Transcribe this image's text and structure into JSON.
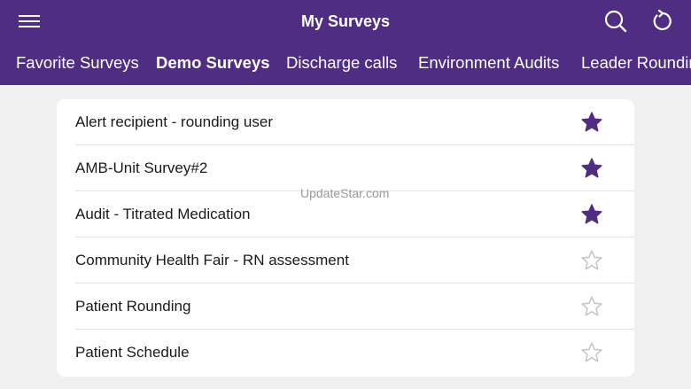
{
  "header": {
    "title": "My Surveys",
    "background_color": "#4e2d82",
    "menu_icon": "hamburger-menu-icon",
    "search_icon": "search-icon",
    "refresh_icon": "refresh-icon"
  },
  "tabs": [
    {
      "label": "Favorite Surveys",
      "active": false
    },
    {
      "label": "Demo Surveys",
      "active": true
    },
    {
      "label": "Discharge calls",
      "active": false
    },
    {
      "label": "Environment Audits",
      "active": false
    },
    {
      "label": "Leader Rounding",
      "active": false
    }
  ],
  "surveys": [
    {
      "name": "Alert recipient - rounding user",
      "favorite": true
    },
    {
      "name": "AMB-Unit Survey#2",
      "favorite": true
    },
    {
      "name": "Audit - Titrated Medication",
      "favorite": true
    },
    {
      "name": "Community Health Fair - RN assessment",
      "favorite": false
    },
    {
      "name": "Patient Rounding",
      "favorite": false
    },
    {
      "name": "Patient Schedule",
      "favorite": false
    }
  ],
  "colors": {
    "accent": "#4e2d82",
    "favorite_star": "#4e2d82",
    "unfavorite_star": "#c4c4c4"
  },
  "watermark": "UpdateStar.com"
}
